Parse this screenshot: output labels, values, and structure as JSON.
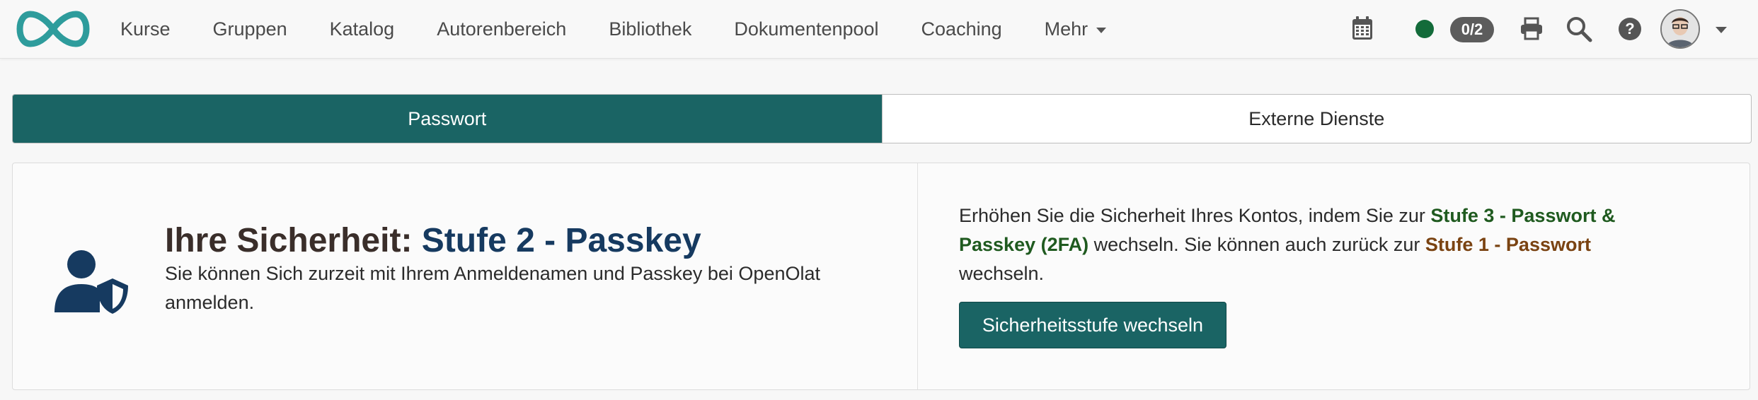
{
  "nav": {
    "items": [
      {
        "id": "kurse",
        "label": "Kurse"
      },
      {
        "id": "gruppen",
        "label": "Gruppen"
      },
      {
        "id": "katalog",
        "label": "Katalog"
      },
      {
        "id": "autorenbereich",
        "label": "Autorenbereich"
      },
      {
        "id": "bibliothek",
        "label": "Bibliothek"
      },
      {
        "id": "dokumentenpool",
        "label": "Dokumentenpool"
      },
      {
        "id": "coaching",
        "label": "Coaching"
      }
    ],
    "more_label": "Mehr",
    "icons": [
      "infinity-logo-icon",
      "calendar-icon",
      "printer-icon",
      "search-icon",
      "help-icon"
    ],
    "status_color": "#136b3a",
    "counter_label": "0/2",
    "help_label": "?"
  },
  "tabs": [
    {
      "label": "Passwort",
      "active": true
    },
    {
      "label": "Externe Dienste",
      "active": false
    }
  ],
  "security": {
    "title_prefix": "Ihre Sicherheit:",
    "level_label": "Stufe 2 - Passkey",
    "description": "Sie können Sich zurzeit mit Ihrem Anmeldenamen und Passkey bei OpenOlat anmelden.",
    "icon": "user-shield-icon",
    "upgrade_text_1": "Erhöhen Sie die Sicherheit Ihres Kontos, indem Sie zur",
    "upgrade_level": "Stufe 3 - Passwort & Passkey (2FA)",
    "upgrade_text_2": "wechseln. Sie können auch zurück zur",
    "downgrade_level": "Stufe 1 - Passwort",
    "upgrade_text_3": "wechseln.",
    "button_label": "Sicherheitsstufe wechseln"
  },
  "colors": {
    "accent": "#1a6464",
    "logo": "#2e9c9c",
    "level_current": "#163a60",
    "level_up": "#1f5a1f",
    "level_down": "#7a4312"
  }
}
